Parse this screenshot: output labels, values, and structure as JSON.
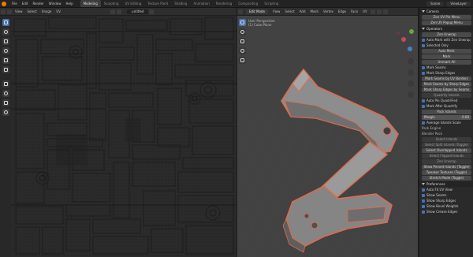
{
  "topbar": {
    "menu": [
      "File",
      "Edit",
      "Render",
      "Window",
      "Help"
    ],
    "workspaces": [
      {
        "label": "Modeling",
        "active": true
      },
      {
        "label": "Sculpting",
        "active": false
      },
      {
        "label": "UV Editing",
        "active": false
      },
      {
        "label": "Texture Paint",
        "active": false
      },
      {
        "label": "Shading",
        "active": false
      },
      {
        "label": "Animation",
        "active": false
      },
      {
        "label": "Rendering",
        "active": false
      },
      {
        "label": "Compositing",
        "active": false
      },
      {
        "label": "Scripting",
        "active": false
      }
    ],
    "scene": "Scene",
    "view_layer": "ViewLayer"
  },
  "uv_editor": {
    "header_buttons": [
      "View",
      "Select",
      "Image",
      "UV"
    ],
    "image_name": "untitled",
    "background": "#2b2b2b",
    "line_color": "#1c1c1c"
  },
  "viewport": {
    "mode": "Edit Mode",
    "header_buttons": [
      "View",
      "Select",
      "Add",
      "Mesh",
      "Vertex",
      "Edge",
      "Face",
      "UV"
    ],
    "info_line1": "User Perspective",
    "info_line2": "(1) Cube.Plane",
    "background": "#424242",
    "outline_color": "#e06a4c"
  },
  "properties": {
    "sections": [
      {
        "title": "Camera",
        "rows": [
          {
            "type": "button",
            "label": "Zen UV Pie Menu"
          },
          {
            "type": "button",
            "label": "Zen UV Popup Menu"
          }
        ]
      },
      {
        "title": "Operators",
        "rows": [
          {
            "type": "button",
            "label": "Zen Unwrap"
          },
          {
            "type": "check",
            "label": "Auto Mark with Zen Unwrap"
          },
          {
            "type": "check",
            "label": "Selected Only"
          },
          {
            "type": "button",
            "label": "Auto Mark"
          },
          {
            "type": "button",
            "label": "Mark"
          },
          {
            "type": "button",
            "label": "Unmark All"
          },
          {
            "type": "check",
            "label": "Mark Seams"
          },
          {
            "type": "check",
            "label": "Mark Sharp Edges"
          },
          {
            "type": "button",
            "label": "Mark Seams by UV Borders"
          },
          {
            "type": "button",
            "label": "Mark Seams by Sharp Edges"
          },
          {
            "type": "button",
            "label": "Mark Sharp Edges by Seams"
          },
          {
            "type": "button_dark",
            "label": "Quadrify Islands"
          },
          {
            "type": "check",
            "label": "Auto Pin QuadriFied"
          },
          {
            "type": "check",
            "label": "Mark After Quadrify"
          },
          {
            "type": "button",
            "label": "Pack Islands"
          },
          {
            "type": "field",
            "label": "Margin",
            "value": "0.00"
          },
          {
            "type": "check",
            "label": "Average Islands Scale"
          },
          {
            "type": "label",
            "label": "Pack Engine"
          },
          {
            "type": "label",
            "label": "Blender Pack"
          },
          {
            "type": "button_dark",
            "label": "Select Islands"
          },
          {
            "type": "button_dark",
            "label": "Select Split Islands (Toggle)"
          },
          {
            "type": "button",
            "label": "Select Overlapped Islands"
          },
          {
            "type": "button_dark",
            "label": "Select Flipped Islands"
          },
          {
            "type": "button_dark",
            "label": "Zen Unwrap"
          },
          {
            "type": "button",
            "label": "Show Pinned Islands (Toggle)"
          },
          {
            "type": "button",
            "label": "Tweaker Textures (Toggle)"
          },
          {
            "type": "button",
            "label": "Stretch Mode (Toggle)"
          }
        ]
      },
      {
        "title": "Preferences",
        "rows": [
          {
            "type": "check",
            "label": "Auto Fit UV View"
          },
          {
            "type": "check",
            "label": "Show Seams"
          },
          {
            "type": "check",
            "label": "Show Sharp Edges"
          },
          {
            "type": "check",
            "label": "Show Bevel Weights"
          },
          {
            "type": "check",
            "label": "Show Crease Edges"
          }
        ]
      }
    ]
  }
}
